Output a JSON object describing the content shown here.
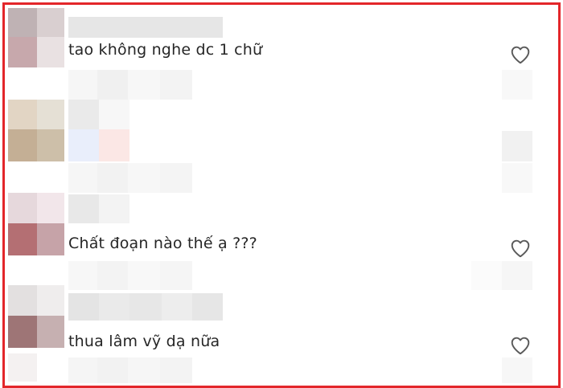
{
  "comments": [
    {
      "text": "tao không nghe dc 1 chữ",
      "liked": false
    },
    {
      "text": "Chất đoạn nào thế ạ ???",
      "liked": false
    },
    {
      "text": "thua lâm vỹ dạ nữa",
      "liked": false
    }
  ],
  "colors": {
    "border": "#e3262a",
    "text": "#262626",
    "icon": "#5a5a5a"
  },
  "icons": [
    "heart-icon"
  ]
}
